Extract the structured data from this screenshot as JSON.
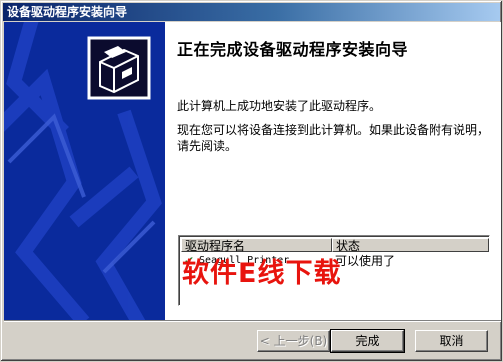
{
  "window": {
    "title": "设备驱动程序安装向导"
  },
  "content": {
    "heading": "正在完成设备驱动程序安装向导",
    "para1": "此计算机上成功地安装了此驱动程序。",
    "para2": "现在您可以将设备连接到此计算机。如果此设备附有说明，请先阅读。"
  },
  "driver_list": {
    "columns": [
      "驱动程序名",
      "状态"
    ],
    "rows": [
      {
        "name": "Seagull Printer ...",
        "status": "可以使用了"
      }
    ]
  },
  "watermark": "软件E线下载",
  "buttons": {
    "back": "< 上一步(B)",
    "finish": "完成",
    "cancel": "取消"
  },
  "colors": {
    "banner": "#0a2a9c",
    "titlebar": "#0a246a",
    "watermark": "#e8140e"
  },
  "icons": {
    "banner_art": "installer-box-icon"
  }
}
